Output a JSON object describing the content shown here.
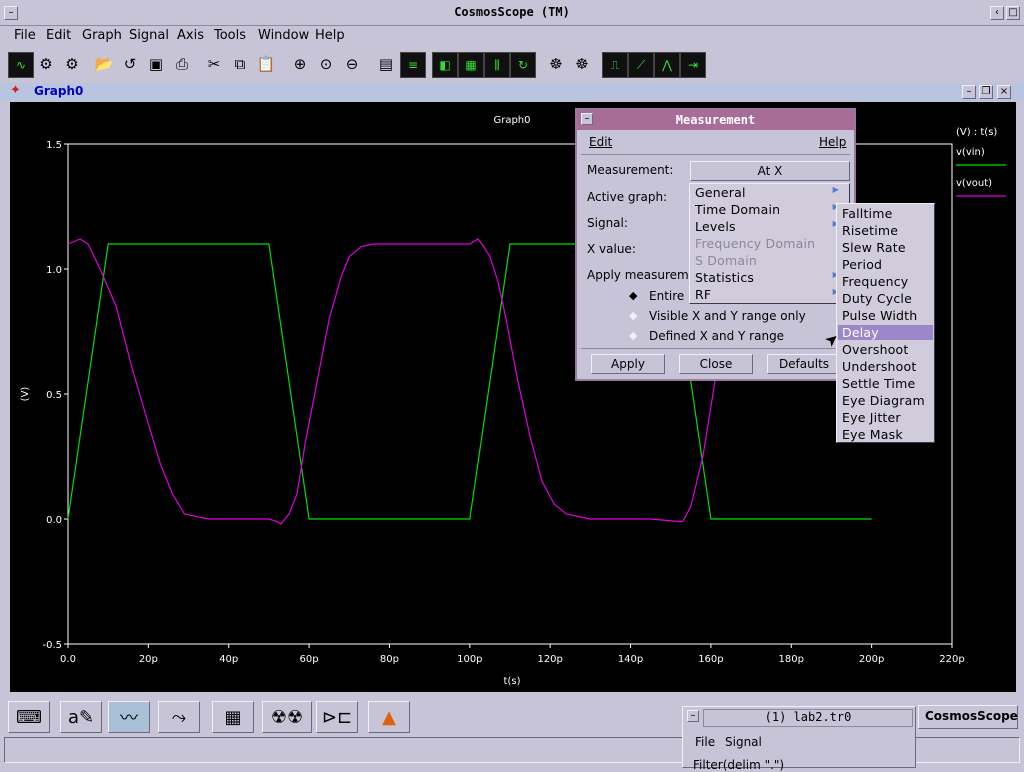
{
  "window": {
    "title": "CosmosScope (TM)"
  },
  "menubar": [
    "File",
    "Edit",
    "Graph",
    "Signal",
    "Axis",
    "Tools",
    "Window",
    "Help"
  ],
  "toolbar_icons": [
    "waveform-icon",
    "gear-icon",
    "gear-alt-icon",
    "open-folder-icon",
    "reload-icon",
    "save-icon",
    "print-icon",
    "cut-icon",
    "copy-icon",
    "paste-icon",
    "zoom-in-icon",
    "zoom-fit-icon",
    "zoom-out-icon",
    "stack-icon",
    "list-icon",
    "eraser-icon",
    "grid-icon",
    "bars-icon",
    "refresh-icon",
    "bug-icon",
    "bug-alt-icon",
    "measure-pulse-icon",
    "measure-rise-icon",
    "measure-peak-icon",
    "measure-delay-icon"
  ],
  "graph": {
    "window_name": "Graph0",
    "plot_title": "Graph0",
    "xlabel": "t(s)",
    "ylabel": "(V)",
    "legend_header": "(V) : t(s)",
    "legend": [
      {
        "name": "v(vin)",
        "color": "#00e000"
      },
      {
        "name": "v(vout)",
        "color": "#e000e0"
      }
    ]
  },
  "chart_data": {
    "type": "line",
    "title": "Graph0",
    "xlabel": "t(s)",
    "ylabel": "(V)",
    "xlim": [
      0,
      220
    ],
    "ylim": [
      -0.5,
      1.5
    ],
    "xticks": [
      "0.0",
      "20p",
      "40p",
      "60p",
      "80p",
      "100p",
      "120p",
      "140p",
      "160p",
      "180p",
      "200p",
      "220p"
    ],
    "yticks": [
      "-0.5",
      "0.0",
      "0.5",
      "1.0",
      "1.5"
    ],
    "grid": false,
    "legend_position": "right",
    "series": [
      {
        "name": "v(vin)",
        "color": "#00e000",
        "x": [
          0,
          10,
          50,
          60,
          100,
          110,
          150,
          160,
          200
        ],
        "y": [
          0.0,
          1.1,
          1.1,
          0.0,
          0.0,
          1.1,
          1.1,
          0.0,
          0.0
        ]
      },
      {
        "name": "v(vout)",
        "color": "#e000e0",
        "x": [
          0,
          3,
          5,
          8,
          12,
          16,
          20,
          23,
          26,
          29,
          35,
          45,
          50,
          52,
          53,
          55,
          57,
          59,
          62,
          65,
          68,
          70,
          73,
          76,
          80,
          90,
          100,
          102,
          103,
          105,
          107,
          109,
          112,
          115,
          118,
          121,
          124,
          127,
          130,
          135,
          145,
          152,
          153,
          155,
          158,
          161,
          163
        ],
        "y": [
          1.1,
          1.12,
          1.1,
          1.0,
          0.85,
          0.6,
          0.38,
          0.22,
          0.1,
          0.02,
          0.0,
          0.0,
          0.0,
          -0.01,
          -0.02,
          0.02,
          0.1,
          0.3,
          0.55,
          0.8,
          0.97,
          1.05,
          1.09,
          1.1,
          1.1,
          1.1,
          1.1,
          1.12,
          1.1,
          1.05,
          0.95,
          0.8,
          0.55,
          0.33,
          0.15,
          0.06,
          0.02,
          0.01,
          0.0,
          0.0,
          0.0,
          -0.01,
          -0.01,
          0.05,
          0.25,
          0.55,
          0.85
        ]
      }
    ]
  },
  "measurement_dialog": {
    "title": "Measurement",
    "menu_left": "Edit",
    "menu_right": "Help",
    "measurement_label": "Measurement:",
    "measurement_value": "At X",
    "active_graph_label": "Active graph:",
    "signal_label": "Signal:",
    "x_value_label": "X value:",
    "apply_label": "Apply measureme",
    "radio_entire": "Entire",
    "radio_visible": "Visible X and Y range only",
    "radio_defined": "Defined X and Y range",
    "btn_apply": "Apply",
    "btn_close": "Close",
    "btn_defaults": "Defaults"
  },
  "category_menu": [
    {
      "label": "General",
      "disabled": false
    },
    {
      "label": "Time Domain",
      "disabled": false
    },
    {
      "label": "Levels",
      "disabled": false
    },
    {
      "label": "Frequency Domain",
      "disabled": true
    },
    {
      "label": "S Domain",
      "disabled": true
    },
    {
      "label": "Statistics",
      "disabled": false
    },
    {
      "label": "RF",
      "disabled": false
    }
  ],
  "time_domain_menu": [
    "Falltime",
    "Risetime",
    "Slew Rate",
    "Period",
    "Frequency",
    "Duty Cycle",
    "Pulse Width",
    "Delay",
    "Overshoot",
    "Undershoot",
    "Settle Time",
    "Eye Diagram",
    "Eye Jitter",
    "Eye Mask"
  ],
  "time_domain_selected": "Delay",
  "taskbar": {
    "icons": [
      "keyboard-icon",
      "pen-icon",
      "waveform-viewer-icon",
      "path-icon",
      "calculator-icon",
      "radiation-icon",
      "flow-diagram-icon",
      "matlab-icon"
    ],
    "app_name": "CosmosScope"
  },
  "signal_window": {
    "title": "(1) lab2.tr0",
    "menu": [
      "File",
      "Signal"
    ],
    "filter_label": "Filter(delim \".\")"
  }
}
